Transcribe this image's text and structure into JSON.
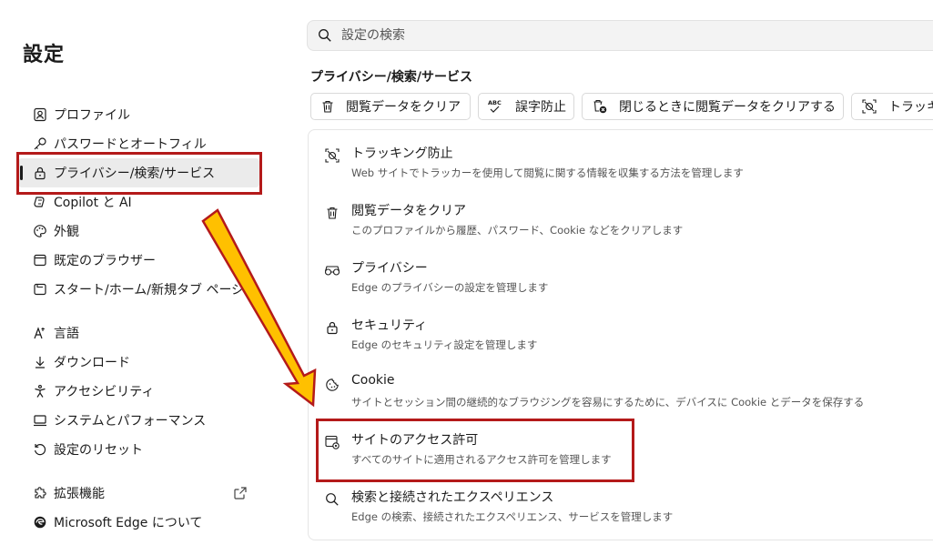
{
  "sidebar": {
    "title": "設定",
    "items": [
      {
        "label": "プロファイル",
        "icon": "profile-icon"
      },
      {
        "label": "パスワードとオートフィル",
        "icon": "key-icon"
      },
      {
        "label": "プライバシー/検索/サービス",
        "icon": "lock-icon",
        "active": true
      },
      {
        "label": "Copilot と AI",
        "icon": "copilot-icon"
      },
      {
        "label": "外観",
        "icon": "palette-icon"
      },
      {
        "label": "既定のブラウザー",
        "icon": "browser-icon"
      },
      {
        "label": "スタート/ホーム/新規タブ ページ",
        "icon": "home-icon"
      },
      {
        "label": "言語",
        "icon": "language-icon"
      },
      {
        "label": "ダウンロード",
        "icon": "download-icon"
      },
      {
        "label": "アクセシビリティ",
        "icon": "accessibility-icon"
      },
      {
        "label": "システムとパフォーマンス",
        "icon": "system-icon"
      },
      {
        "label": "設定のリセット",
        "icon": "reset-icon"
      },
      {
        "label": "拡張機能",
        "icon": "puzzle-icon"
      },
      {
        "label": "Microsoft Edge について",
        "icon": "edge-logo-icon"
      }
    ]
  },
  "search": {
    "placeholder": "設定の検索"
  },
  "main": {
    "section_title": "プライバシー/検索/サービス",
    "chips": [
      {
        "label": "閲覧データをクリア",
        "icon": "trash-icon"
      },
      {
        "label": "誤字防止",
        "icon": "spellcheck-icon"
      },
      {
        "label": "閉じるときに閲覧データをクリアする",
        "icon": "clear-on-close-icon"
      },
      {
        "label": "トラッキ",
        "icon": "tracking-icon"
      }
    ],
    "rows": [
      {
        "title": "トラッキング防止",
        "desc": "Web サイトでトラッカーを使用して閲覧に関する情報を収集する方法を管理します",
        "icon": "tracking-icon"
      },
      {
        "title": "閲覧データをクリア",
        "desc": "このプロファイルから履歴、パスワード、Cookie などをクリアします",
        "icon": "trash-icon"
      },
      {
        "title": "プライバシー",
        "desc": "Edge のプライバシーの設定を管理します",
        "icon": "glasses-icon"
      },
      {
        "title": "セキュリティ",
        "desc": "Edge のセキュリティ設定を管理します",
        "icon": "lock-icon"
      },
      {
        "title": "Cookie",
        "desc": "サイトとセッション間の継続的なブラウジングを容易にするために、デバイスに Cookie とデータを保存する",
        "icon": "cookie-icon"
      },
      {
        "title": "サイトのアクセス許可",
        "desc": "すべてのサイトに適用されるアクセス許可を管理します",
        "icon": "site-permissions-icon"
      },
      {
        "title": "検索と接続されたエクスペリエンス",
        "desc": "Edge の検索、接続されたエクスペリエンス、サービスを管理します",
        "icon": "search-icon"
      }
    ]
  },
  "annotations": {
    "highlight_color": "#b41a1a",
    "arrow_fill": "#ffc000",
    "arrow_stroke": "#b41a1a"
  }
}
